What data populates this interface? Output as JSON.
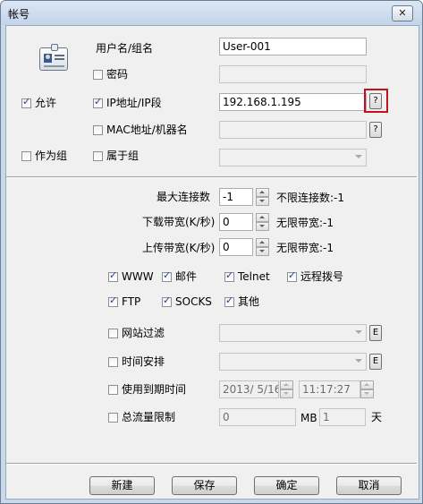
{
  "window": {
    "title": "帐号",
    "close_glyph": "✕"
  },
  "left": {
    "allow": {
      "label": "允许",
      "checked": true
    },
    "as_group": {
      "label": "作为组",
      "checked": false
    }
  },
  "account": {
    "username_label": "用户名/组名",
    "username_value": "User-001",
    "password": {
      "label": "密码",
      "checked": false,
      "value": ""
    },
    "ip": {
      "label": "IP地址/IP段",
      "checked": true,
      "value": "192.168.1.195",
      "help": "?"
    },
    "mac": {
      "label": "MAC地址/机器名",
      "checked": false,
      "value": "",
      "help": "?"
    },
    "group": {
      "label": "属于组",
      "checked": false,
      "value": ""
    }
  },
  "limits": {
    "max_conn": {
      "label": "最大连接数",
      "value": "-1",
      "hint": "不限连接数:-1"
    },
    "download": {
      "label": "下载带宽(K/秒)",
      "value": "0",
      "hint": "无限带宽:-1"
    },
    "upload": {
      "label": "上传带宽(K/秒)",
      "value": "0",
      "hint": "无限带宽:-1"
    }
  },
  "services": [
    {
      "label": "WWW",
      "checked": true
    },
    {
      "label": "邮件",
      "checked": true
    },
    {
      "label": "Telnet",
      "checked": true
    },
    {
      "label": "远程拨号",
      "checked": true
    },
    {
      "label": "FTP",
      "checked": true
    },
    {
      "label": "SOCKS",
      "checked": true
    },
    {
      "label": "其他",
      "checked": true
    }
  ],
  "options": {
    "site_filter": {
      "label": "网站过滤",
      "checked": false,
      "edit": "E"
    },
    "schedule": {
      "label": "时间安排",
      "checked": false,
      "edit": "E"
    },
    "expiry": {
      "label": "使用到期时间",
      "checked": false,
      "date": "2013/ 5/16",
      "time": "11:17:27"
    },
    "traffic": {
      "label": "总流量限制",
      "checked": false,
      "value": "0",
      "unit_mb": "MB",
      "days": "1",
      "unit_day": "天"
    }
  },
  "buttons": {
    "new": "新建",
    "save": "保存",
    "ok": "确定",
    "cancel": "取消"
  },
  "colors": {
    "highlight": "#c0141d",
    "check": "#23439a"
  }
}
